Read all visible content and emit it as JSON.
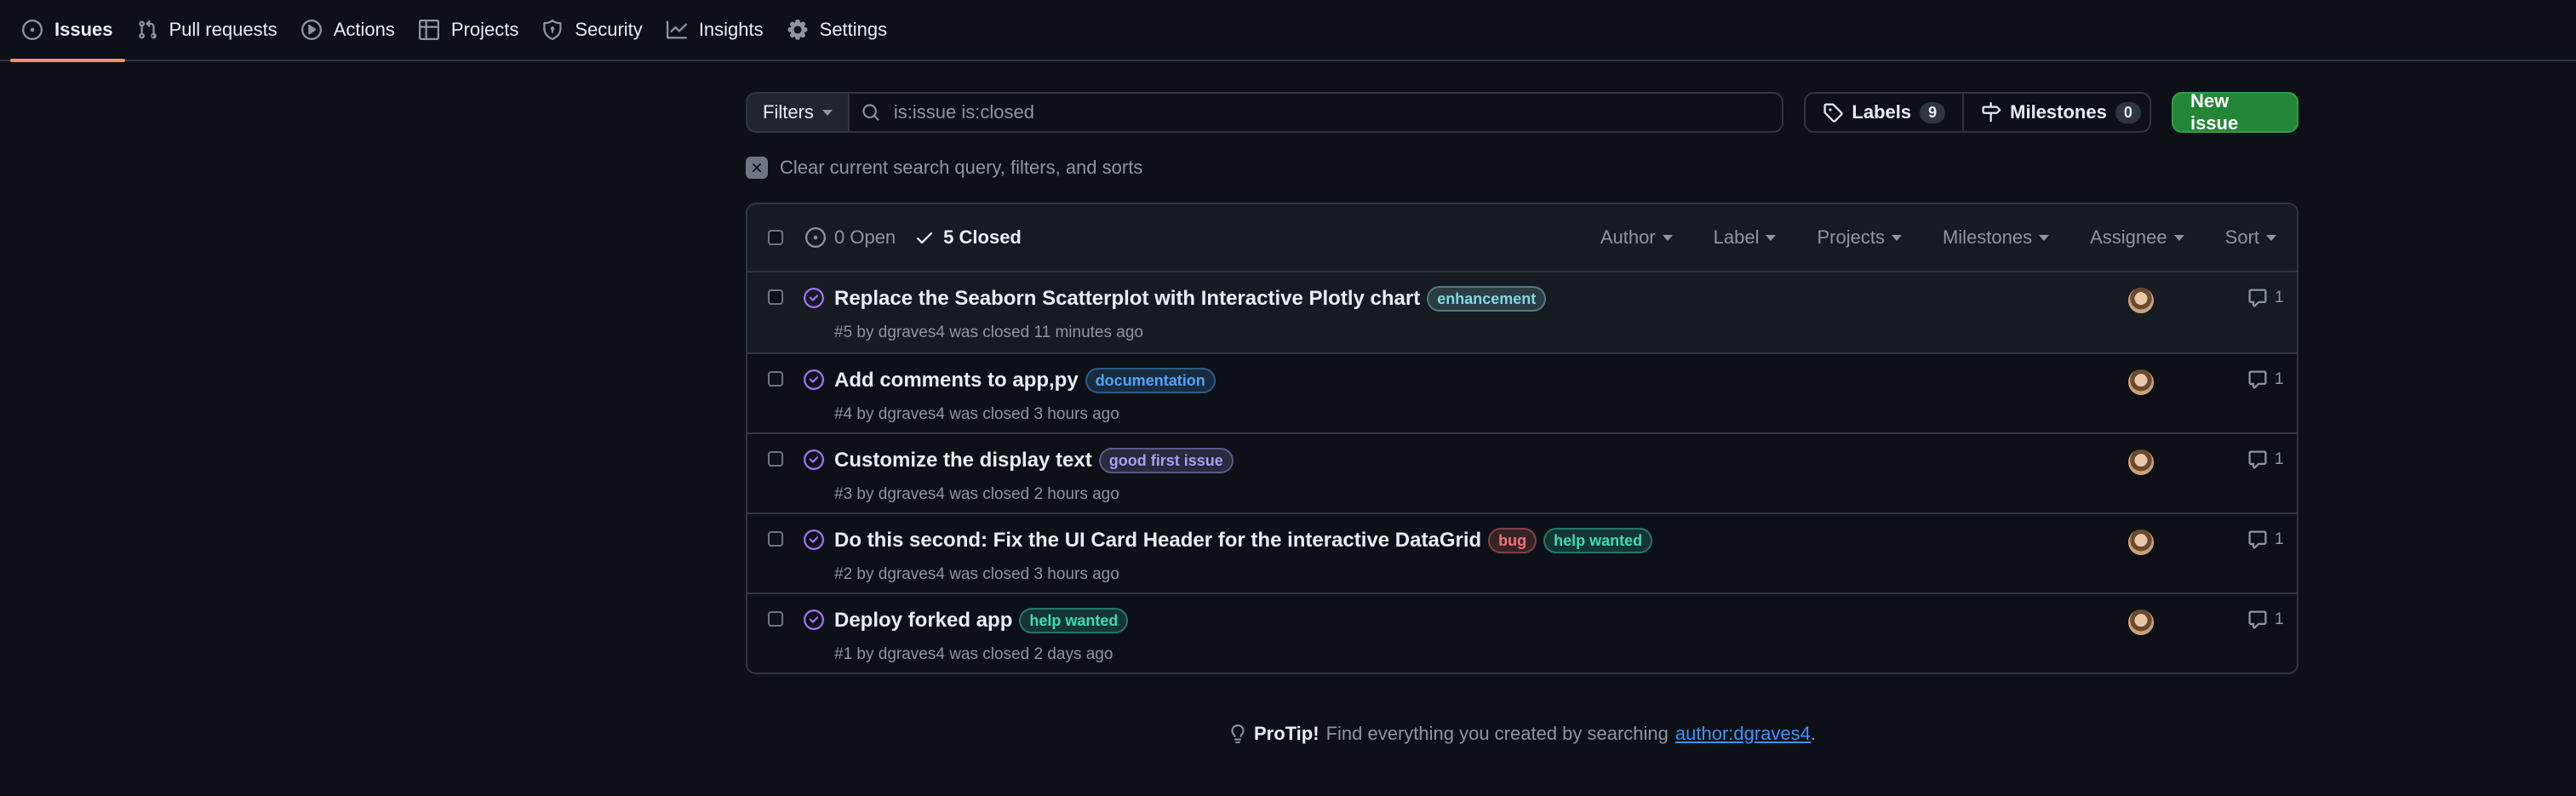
{
  "nav": {
    "tabs": [
      {
        "label": "Issues",
        "icon": "issue-opened-icon",
        "selected": true
      },
      {
        "label": "Pull requests",
        "icon": "git-pull-request-icon"
      },
      {
        "label": "Actions",
        "icon": "play-icon"
      },
      {
        "label": "Projects",
        "icon": "table-icon"
      },
      {
        "label": "Security",
        "icon": "shield-icon"
      },
      {
        "label": "Insights",
        "icon": "graph-icon"
      },
      {
        "label": "Settings",
        "icon": "gear-icon"
      }
    ]
  },
  "toolbar": {
    "filters_label": "Filters",
    "search_value": "is:issue is:closed",
    "labels_label": "Labels",
    "labels_count": "9",
    "milestones_label": "Milestones",
    "milestones_count": "0",
    "new_issue_label": "New issue"
  },
  "clear_query": {
    "label": "Clear current search query, filters, and sorts"
  },
  "list_header": {
    "open_label": "0 Open",
    "closed_label": "5 Closed",
    "filters": [
      "Author",
      "Label",
      "Projects",
      "Milestones",
      "Assignee",
      "Sort"
    ]
  },
  "issues": [
    {
      "title": "Replace the Seaborn Scatterplot with Interactive Plotly chart",
      "labels": [
        {
          "name": "enhancement",
          "color": "#84d6e0"
        }
      ],
      "meta": "#5 by dgraves4 was closed 11 minutes ago",
      "comments": "1"
    },
    {
      "title": "Add comments to app,py",
      "labels": [
        {
          "name": "documentation",
          "color": "#4ea5f8"
        }
      ],
      "meta": "#4 by dgraves4 was closed 3 hours ago",
      "comments": "1"
    },
    {
      "title": "Customize the display text",
      "labels": [
        {
          "name": "good first issue",
          "color": "#a79ff6"
        }
      ],
      "meta": "#3 by dgraves4 was closed 2 hours ago",
      "comments": "1"
    },
    {
      "title": "Do this second: Fix the UI Card Header for the interactive DataGrid",
      "labels": [
        {
          "name": "bug",
          "color": "#f47373"
        },
        {
          "name": "help wanted",
          "color": "#3fdcb0"
        }
      ],
      "meta": "#2 by dgraves4 was closed 3 hours ago",
      "comments": "1"
    },
    {
      "title": "Deploy forked app",
      "labels": [
        {
          "name": "help wanted",
          "color": "#3fdcb0"
        }
      ],
      "meta": "#1 by dgraves4 was closed 2 days ago",
      "comments": "1"
    }
  ],
  "protip": {
    "bold": "ProTip!",
    "text": "Find everything you created by searching",
    "link": "author:dgraves4",
    "end": "."
  }
}
